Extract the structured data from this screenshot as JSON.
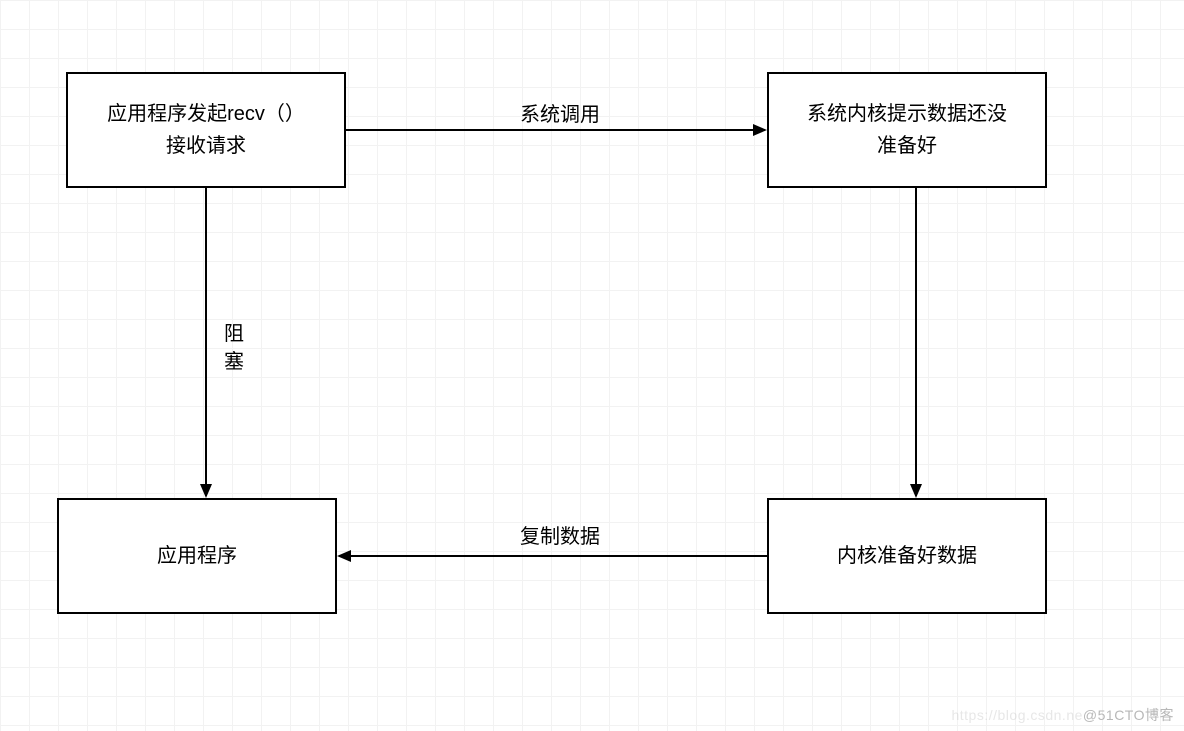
{
  "boxes": {
    "top_left": "应用程序发起recv（）\n接收请求",
    "top_right": "系统内核提示数据还没\n准备好",
    "bottom_left": "应用程序",
    "bottom_right": "内核准备好数据"
  },
  "edges": {
    "top": "系统调用",
    "left": "阻塞",
    "bottom": "复制数据"
  },
  "watermark": {
    "faded_prefix": "https://blog.csdn.ne",
    "text": "@51CTO博客"
  }
}
